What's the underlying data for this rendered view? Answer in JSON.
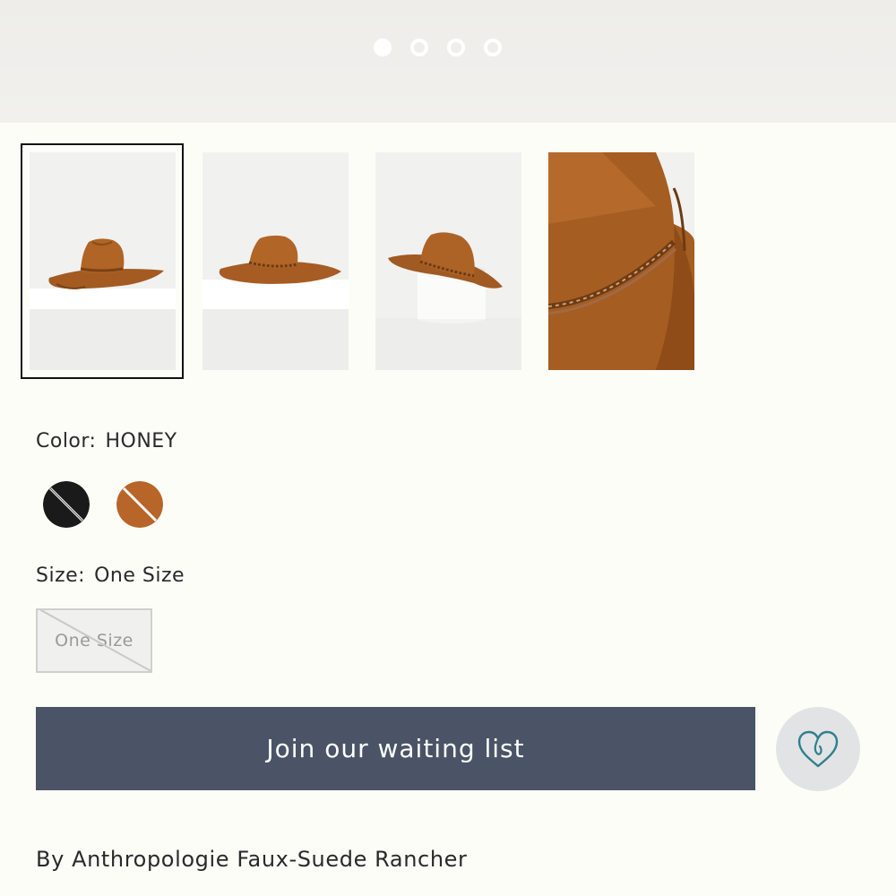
{
  "carousel": {
    "dots": [
      {
        "state": "active"
      },
      {
        "state": "inactive"
      },
      {
        "state": "inactive"
      },
      {
        "state": "inactive"
      }
    ]
  },
  "thumbnails": [
    {
      "icon": "hat-side-view-image",
      "selected": true
    },
    {
      "icon": "hat-side-view-image",
      "selected": false
    },
    {
      "icon": "hat-on-stand-image",
      "selected": false
    },
    {
      "icon": "hat-closeup-image",
      "selected": false
    }
  ],
  "color": {
    "label": "Color:",
    "value": "HONEY",
    "swatches": [
      {
        "name": "black",
        "hex": "#1b1a1a",
        "available": false
      },
      {
        "name": "honey",
        "hex": "#b8652a",
        "available": false
      }
    ]
  },
  "size": {
    "label": "Size:",
    "value": "One Size",
    "options": [
      {
        "label": "One Size",
        "available": false
      }
    ]
  },
  "cta": {
    "label": "Join our waiting list",
    "color": "#4a5466"
  },
  "wishlist": {
    "icon": "heart-icon",
    "color": "#2f7f8e"
  },
  "product": {
    "title": "By Anthropologie Faux-Suede Rancher"
  }
}
